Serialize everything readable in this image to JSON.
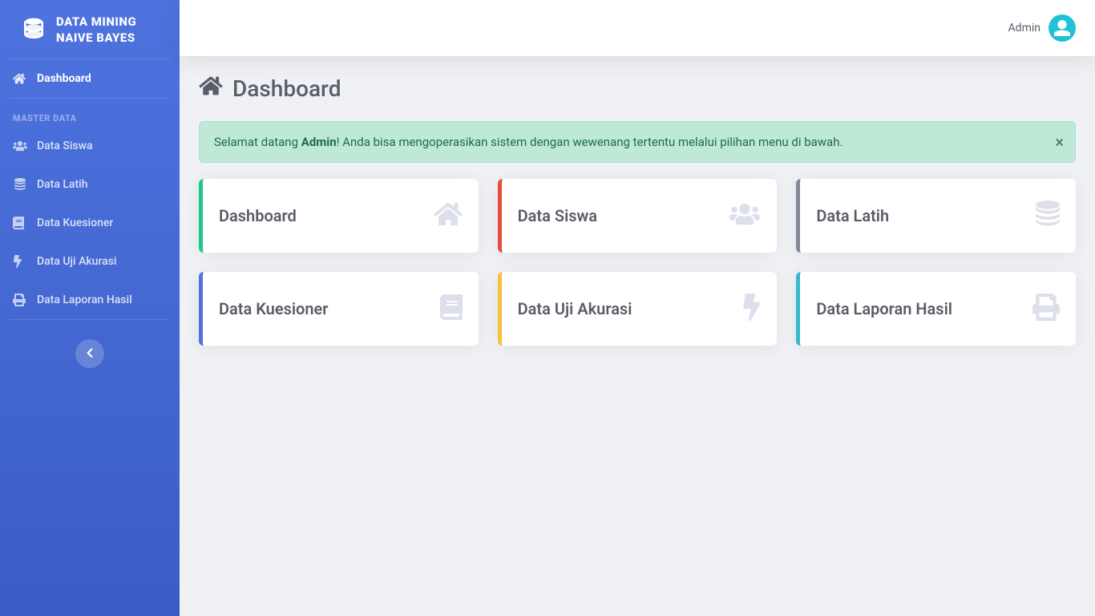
{
  "brand": {
    "line1": "DATA MINING",
    "line2": "NAIVE BAYES"
  },
  "sidebar": {
    "dashboard": "Dashboard",
    "section_heading": "MASTER DATA",
    "items": [
      {
        "label": "Data Siswa"
      },
      {
        "label": "Data Latih"
      },
      {
        "label": "Data Kuesioner"
      },
      {
        "label": "Data Uji Akurasi"
      },
      {
        "label": "Data Laporan Hasil"
      }
    ]
  },
  "topbar": {
    "user_name": "Admin"
  },
  "page": {
    "title": "Dashboard"
  },
  "alert": {
    "prefix": "Selamat datang ",
    "bold": "Admin",
    "suffix": "! Anda bisa mengoperasikan sistem dengan wewenang tertentu melalui pilihan menu di bawah."
  },
  "cards": [
    {
      "title": "Dashboard"
    },
    {
      "title": "Data Siswa"
    },
    {
      "title": "Data Latih"
    },
    {
      "title": "Data Kuesioner"
    },
    {
      "title": "Data Uji Akurasi"
    },
    {
      "title": "Data Laporan Hasil"
    }
  ]
}
